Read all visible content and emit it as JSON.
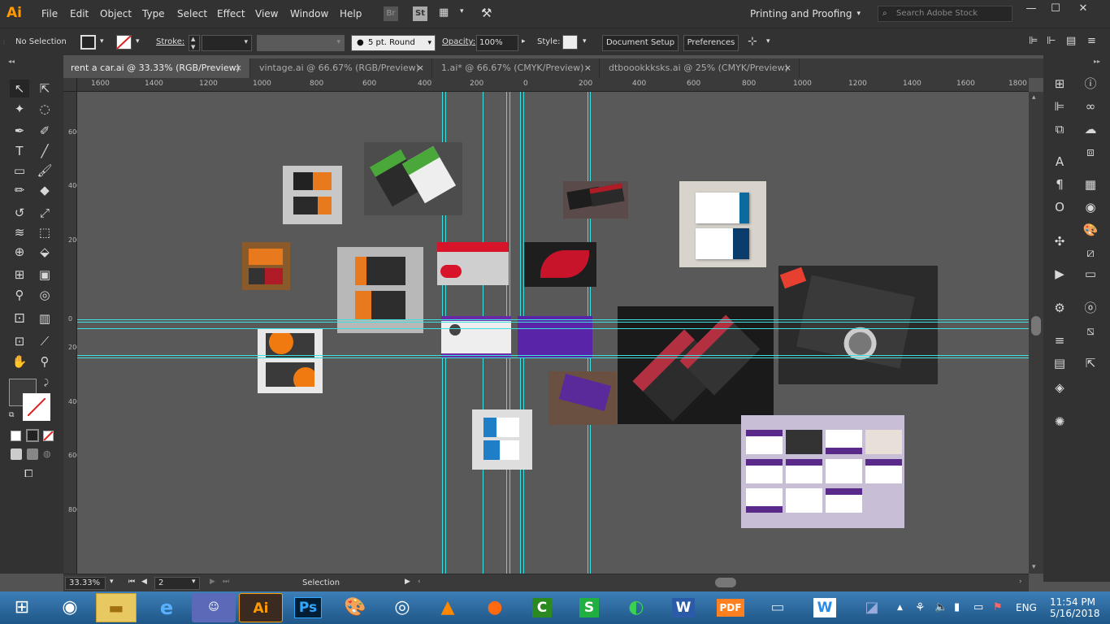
{
  "app": {
    "logo": "Ai",
    "menu": [
      "File",
      "Edit",
      "Object",
      "Type",
      "Select",
      "Effect",
      "View",
      "Window",
      "Help"
    ],
    "bridge": "Br",
    "stock": "St",
    "workspace": "Printing and Proofing",
    "stock_search_placeholder": "Search Adobe Stock"
  },
  "control_bar": {
    "selection": "No Selection",
    "stroke_label": "Stroke:",
    "brush": "5 pt. Round",
    "opacity_label": "Opacity:",
    "opacity_value": "100%",
    "style_label": "Style:",
    "document_setup": "Document Setup",
    "preferences": "Preferences"
  },
  "tabs": [
    {
      "label": "rent a car.ai @ 33.33% (RGB/Preview)",
      "close": "×"
    },
    {
      "label": "vintage.ai @ 66.67% (RGB/Preview)",
      "close": "×"
    },
    {
      "label": "1.ai* @ 66.67% (CMYK/Preview)",
      "close": "×"
    },
    {
      "label": "dtboookkksks.ai @ 25% (CMYK/Preview)",
      "close": "×"
    }
  ],
  "ruler": {
    "h_ticks": [
      "1600",
      "1400",
      "1200",
      "1000",
      "800",
      "600",
      "400",
      "200",
      "0",
      "200",
      "400",
      "600",
      "800",
      "1000",
      "1200",
      "1400",
      "1600",
      "1800"
    ],
    "v_ticks": [
      "600",
      "400",
      "200",
      "0",
      "200",
      "400",
      "600",
      "800"
    ]
  },
  "status": {
    "zoom": "33.33%",
    "artboard": "2",
    "tool": "Selection"
  },
  "taskbar": {
    "time": "11:54 PM",
    "date": "5/16/2018",
    "lang": "ENG",
    "apps": [
      "ie",
      "discord",
      "Ai",
      "Ps",
      "paint",
      "chrome",
      "vlc",
      "firefox",
      "camtasia",
      "sheets",
      "idm",
      "W",
      "pdf",
      "photos",
      "wps",
      "notes"
    ]
  },
  "colors": {
    "accent": "#ff9a00",
    "guide": "#3ee0e0",
    "panel": "#323232",
    "canvas": "#595959"
  }
}
